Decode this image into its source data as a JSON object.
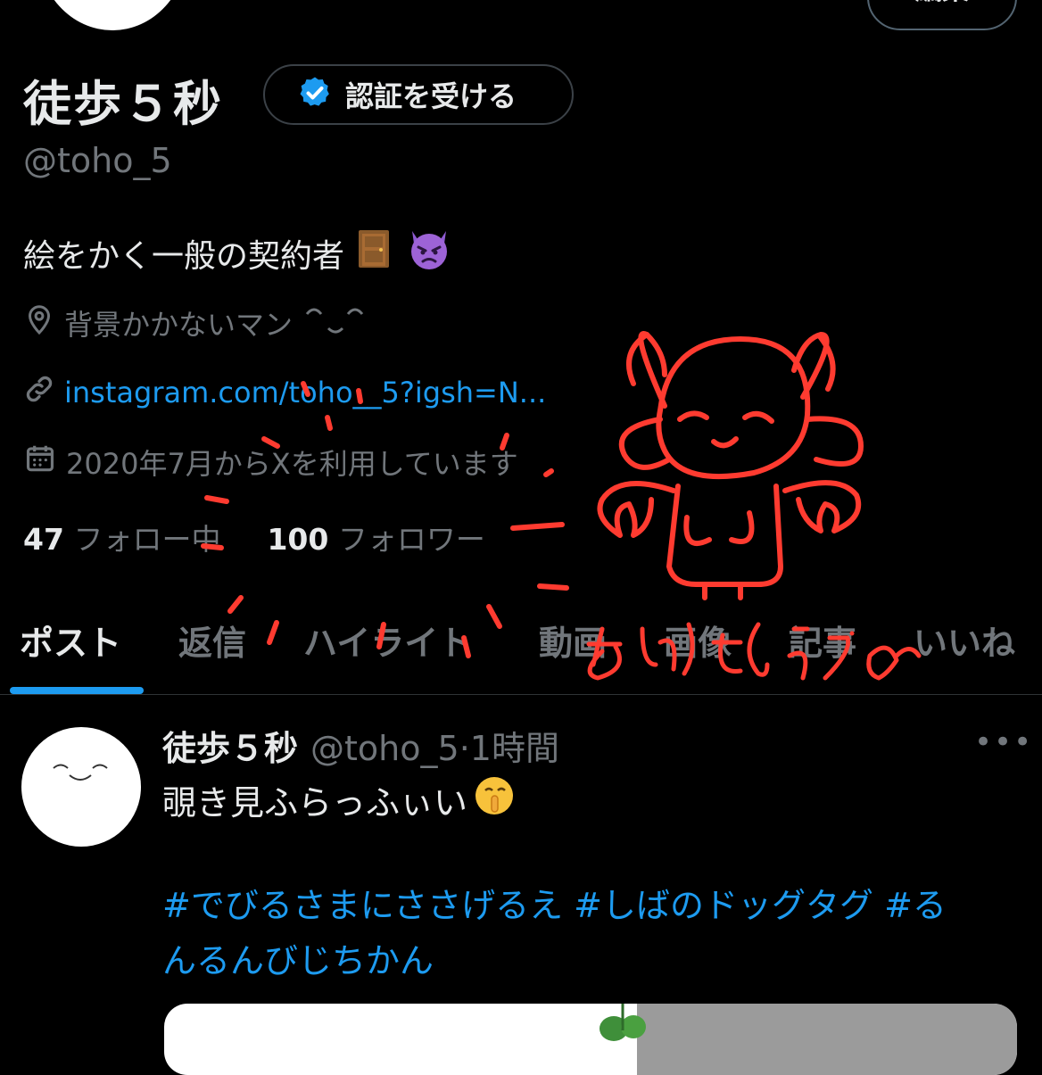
{
  "profile": {
    "edit_button_label": "編集",
    "display_name": "徒歩５秒",
    "verify_button_label": "認証を受ける",
    "handle": "@toho_5",
    "bio": "絵をかく一般の契約者",
    "bio_emojis": [
      "door-emoji",
      "devil-emoji"
    ],
    "location": "背景かかないマン",
    "link": "instagram.com/toho__5?igsh=N...",
    "joined": "2020年7月からXを利用しています",
    "following_count": "47",
    "following_label": "フォロー中",
    "followers_count": "100",
    "followers_label": "フォロワー"
  },
  "tabs": [
    {
      "label": "ポスト",
      "active": true
    },
    {
      "label": "返信"
    },
    {
      "label": "ハイライト"
    },
    {
      "label": "動画"
    },
    {
      "label": "画像"
    },
    {
      "label": "記事"
    },
    {
      "label": "いいね"
    }
  ],
  "post": {
    "name": "徒歩５秒",
    "handle": "@toho_5",
    "time": "·1時間",
    "more": "•••",
    "text": "覗き見ふらっふぃい",
    "text_emoji": "shushing-face-emoji",
    "hashtags_line1": "#でびるさまにささげるえ #しばのドッグタグ #る",
    "hashtags_line2": "んるんびじちかん"
  },
  "drawing": {
    "caption": "ありがとう",
    "color": "#ff3b30"
  },
  "colors": {
    "background": "#000000",
    "text_primary": "#e7e9ea",
    "text_secondary": "#71767b",
    "accent": "#1d9bf0"
  }
}
